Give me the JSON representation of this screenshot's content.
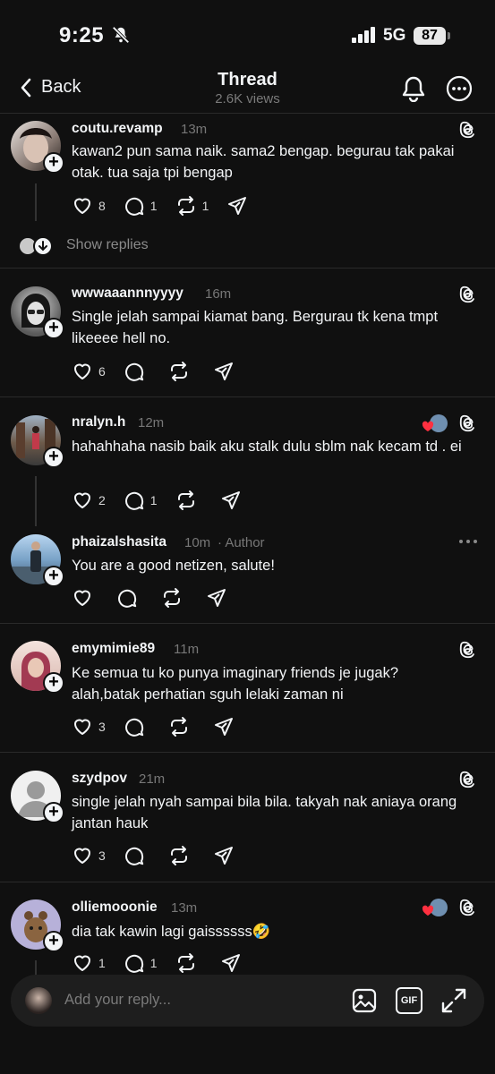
{
  "status": {
    "time": "9:25",
    "network": "5G",
    "battery": "87"
  },
  "nav": {
    "back_label": "Back",
    "title": "Thread",
    "views": "2.6K views"
  },
  "posts": [
    {
      "username": "coutu.revamp",
      "time": "13m",
      "text": "kawan2 pun sama naik. sama2 bengap. begurau tak pakai otak. tua saja tpi bengap",
      "likes": "8",
      "replies": "1",
      "reposts": "1"
    },
    {
      "username": "wwwaaannnyyyy",
      "time": "16m",
      "text": "Single jelah sampai kiamat bang. Bergurau tk kena tmpt likeeee hell no.",
      "likes": "6",
      "replies": "",
      "reposts": ""
    },
    {
      "username": "nralyn.h",
      "time": "12m",
      "text": "hahahhaha nasib baik aku stalk dulu sblm nak kecam td . ei",
      "likes": "2",
      "replies": "1",
      "reposts": ""
    },
    {
      "username": "phaizalshasita",
      "time": "10m",
      "author_tag": "· Author",
      "text": "You are a good netizen, salute!",
      "likes": "",
      "replies": "",
      "reposts": ""
    },
    {
      "username": "emymimie89",
      "time": "11m",
      "text": "Ke semua tu ko punya imaginary friends je jugak? alah,batak perhatian sguh lelaki zaman ni",
      "likes": "3",
      "replies": "",
      "reposts": ""
    },
    {
      "username": "szydpov",
      "time": "21m",
      "text": "single jelah nyah sampai bila bila. takyah nak aniaya orang jantan hauk",
      "likes": "3",
      "replies": "",
      "reposts": ""
    },
    {
      "username": "olliemooonie",
      "time": "13m",
      "text": "dia tak kawin lagi gaissssss🤣",
      "likes": "1",
      "replies": "1",
      "reposts": ""
    }
  ],
  "show_replies": "Show replies",
  "reply_bar": {
    "placeholder": "Add your reply...",
    "gif_label": "GIF"
  },
  "colors": {
    "background": "#101010",
    "text": "#f3f5f7",
    "muted": "#777777",
    "heart": "#ff3040"
  }
}
